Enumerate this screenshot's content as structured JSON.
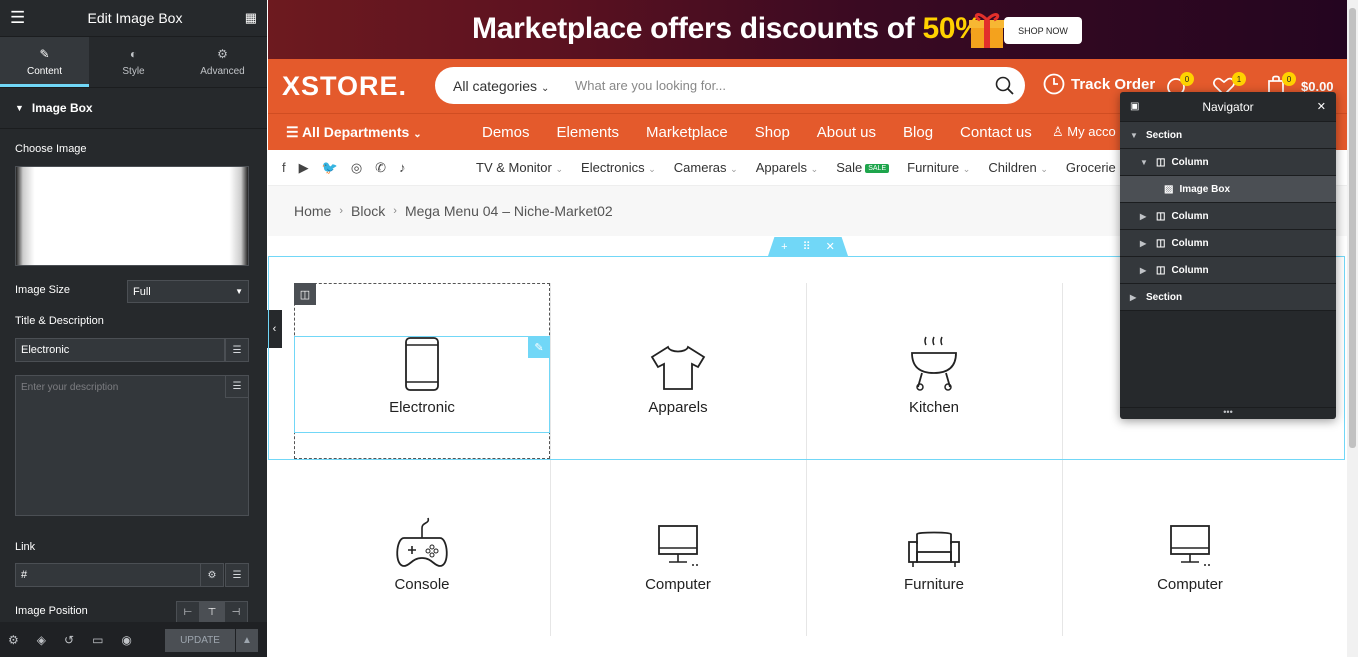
{
  "editor": {
    "title": "Edit Image Box",
    "tabs": [
      {
        "label": "Content"
      },
      {
        "label": "Style"
      },
      {
        "label": "Advanced"
      }
    ],
    "section_title": "Image Box",
    "choose_image_label": "Choose Image",
    "image_size_label": "Image Size",
    "image_size_value": "Full",
    "title_desc_label": "Title & Description",
    "title_value": "Electronic",
    "description_placeholder": "Enter your description",
    "link_label": "Link",
    "link_value": "#",
    "image_position_label": "Image Position",
    "update_label": "UPDATE"
  },
  "banner": {
    "text": "Marketplace offers discounts of ",
    "percent": "50%",
    "shop_button": "SHOP NOW"
  },
  "header": {
    "logo": "XSTORE.",
    "category_select": "All categories",
    "search_placeholder": "What are you looking for...",
    "track_order": "Track Order",
    "compare_count": "0",
    "wishlist_count": "1",
    "cart_count": "0",
    "cart_total": "$0.00"
  },
  "nav": {
    "departments": "All Departments",
    "links": [
      "Demos",
      "Elements",
      "Marketplace",
      "Shop",
      "About us",
      "Blog",
      "Contact us"
    ],
    "account": "My acco"
  },
  "subnav": {
    "categories": [
      "TV & Monitor",
      "Electronics",
      "Cameras",
      "Apparels",
      "Sale",
      "Furniture",
      "Children",
      "Grocerie"
    ],
    "sale_badge": "SALE"
  },
  "breadcrumb": [
    "Home",
    "Block",
    "Mega Menu 04 – Niche-Market02"
  ],
  "grid_items": [
    "Electronic",
    "Apparels",
    "Kitchen",
    "Console",
    "Computer",
    "Furniture",
    "Computer"
  ],
  "navigator": {
    "title": "Navigator",
    "rows": [
      {
        "label": "Section"
      },
      {
        "label": "Column"
      },
      {
        "label": "Image Box"
      },
      {
        "label": "Column"
      },
      {
        "label": "Column"
      },
      {
        "label": "Column"
      },
      {
        "label": "Section"
      }
    ]
  }
}
